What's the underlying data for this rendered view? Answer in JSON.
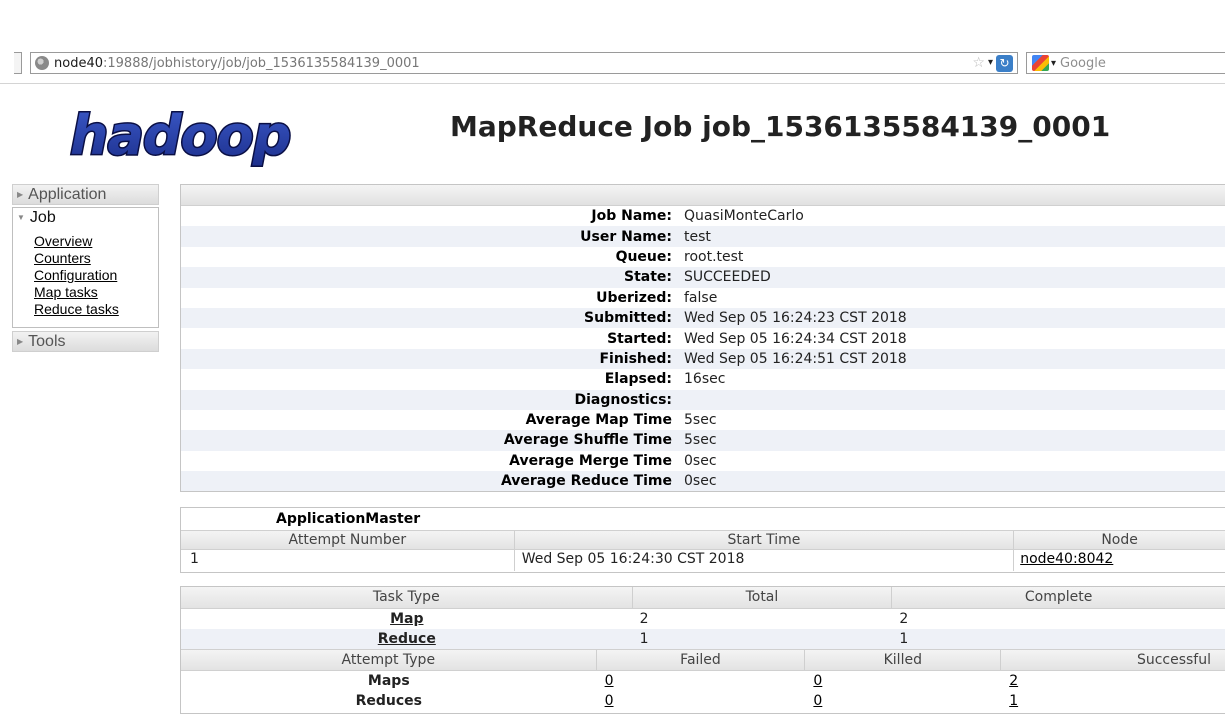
{
  "browser": {
    "url_host": "node40",
    "url_path": ":19888/jobhistory/job/job_1536135584139_0001",
    "search_placeholder": "Google",
    "icons": [
      "globe-icon",
      "star-icon",
      "reload-icon",
      "search-engine-icon"
    ]
  },
  "header": {
    "logo_text": "hadoop",
    "title": "MapReduce Job job_1536135584139_0001"
  },
  "nav": {
    "application": "Application",
    "job": "Job",
    "job_links": [
      "Overview",
      "Counters",
      "Configuration",
      "Map tasks",
      "Reduce tasks"
    ],
    "tools": "Tools"
  },
  "job_info": [
    {
      "label": "Job Name:",
      "value": "QuasiMonteCarlo"
    },
    {
      "label": "User Name:",
      "value": "test"
    },
    {
      "label": "Queue:",
      "value": "root.test"
    },
    {
      "label": "State:",
      "value": "SUCCEEDED"
    },
    {
      "label": "Uberized:",
      "value": "false"
    },
    {
      "label": "Submitted:",
      "value": "Wed Sep 05 16:24:23 CST 2018"
    },
    {
      "label": "Started:",
      "value": "Wed Sep 05 16:24:34 CST 2018"
    },
    {
      "label": "Finished:",
      "value": "Wed Sep 05 16:24:51 CST 2018"
    },
    {
      "label": "Elapsed:",
      "value": "16sec"
    },
    {
      "label": "Diagnostics:",
      "value": ""
    },
    {
      "label": "Average Map Time",
      "value": "5sec"
    },
    {
      "label": "Average Shuffle Time",
      "value": "5sec"
    },
    {
      "label": "Average Merge Time",
      "value": "0sec"
    },
    {
      "label": "Average Reduce Time",
      "value": "0sec"
    }
  ],
  "application_master": {
    "title": "ApplicationMaster",
    "headers": [
      "Attempt Number",
      "Start Time",
      "Node"
    ],
    "row": {
      "attempt": "1",
      "start_time": "Wed Sep 05 16:24:30 CST 2018",
      "node": "node40:8042"
    }
  },
  "tasks": {
    "headers": [
      "Task Type",
      "Total",
      "Complete"
    ],
    "rows": [
      {
        "type": "Map",
        "total": "2",
        "complete": "2"
      },
      {
        "type": "Reduce",
        "total": "1",
        "complete": "1"
      }
    ]
  },
  "attempts": {
    "headers": [
      "Attempt Type",
      "Failed",
      "Killed",
      "Successful"
    ],
    "rows": [
      {
        "type": "Maps",
        "failed": "0",
        "killed": "0",
        "successful": "2"
      },
      {
        "type": "Reduces",
        "failed": "0",
        "killed": "0",
        "successful": "1"
      }
    ]
  }
}
